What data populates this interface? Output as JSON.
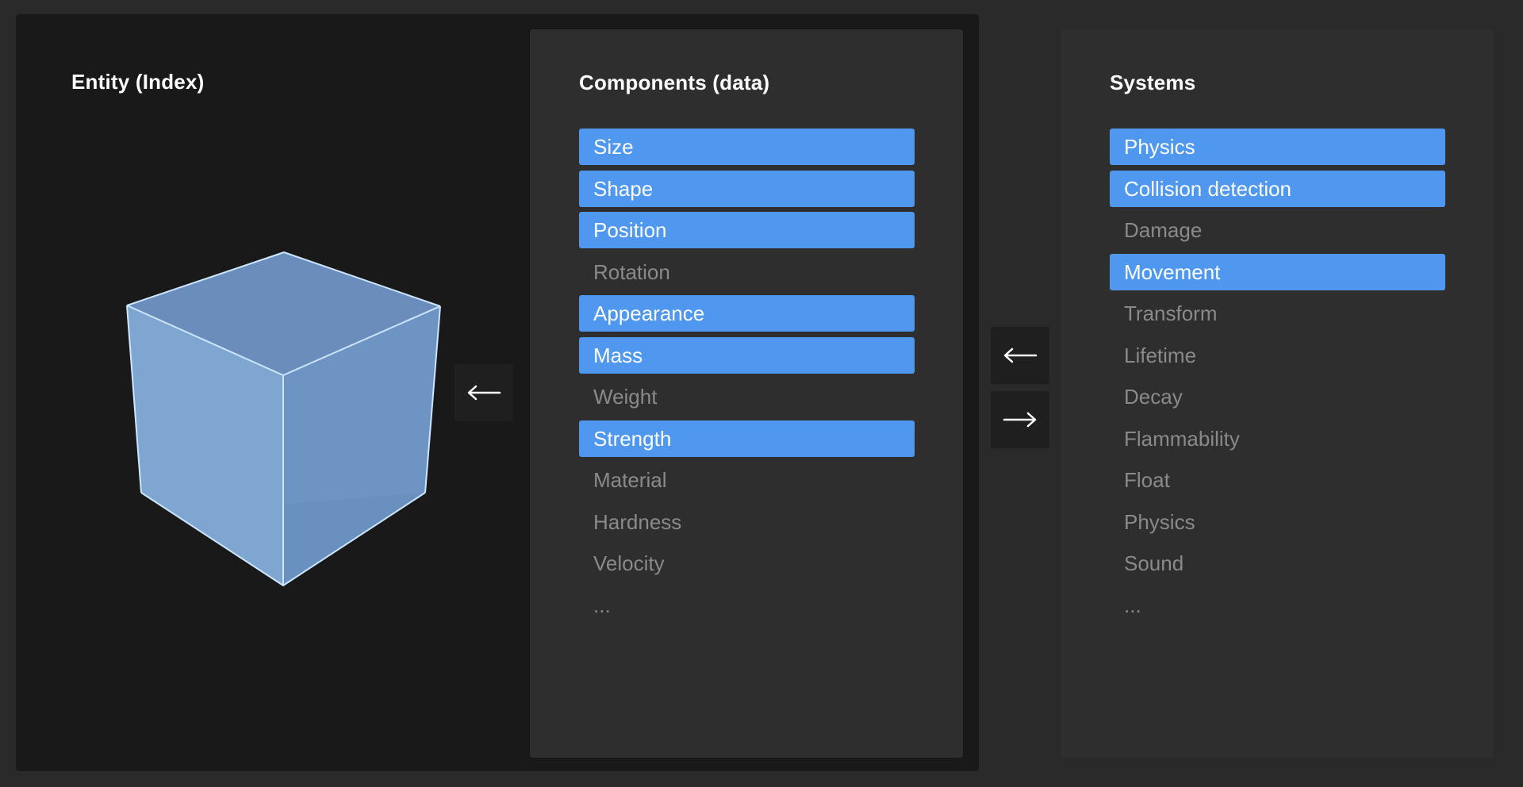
{
  "entity": {
    "title": "Entity (Index)",
    "cube_color": "#7aa4d0",
    "edge_color": "#cde6ff"
  },
  "components": {
    "title": "Components (data)",
    "items": [
      {
        "label": "Size",
        "active": true
      },
      {
        "label": "Shape",
        "active": true
      },
      {
        "label": "Position",
        "active": true
      },
      {
        "label": "Rotation",
        "active": false
      },
      {
        "label": "Appearance",
        "active": true
      },
      {
        "label": "Mass",
        "active": true
      },
      {
        "label": "Weight",
        "active": false
      },
      {
        "label": "Strength",
        "active": true
      },
      {
        "label": "Material",
        "active": false
      },
      {
        "label": "Hardness",
        "active": false
      },
      {
        "label": "Velocity",
        "active": false
      },
      {
        "label": "...",
        "active": false
      }
    ]
  },
  "systems": {
    "title": "Systems",
    "items": [
      {
        "label": "Physics",
        "active": true
      },
      {
        "label": "Collision detection",
        "active": true
      },
      {
        "label": "Damage",
        "active": false
      },
      {
        "label": "Movement",
        "active": true
      },
      {
        "label": "Transform",
        "active": false
      },
      {
        "label": "Lifetime",
        "active": false
      },
      {
        "label": "Decay",
        "active": false
      },
      {
        "label": "Flammability",
        "active": false
      },
      {
        "label": "Float",
        "active": false
      },
      {
        "label": "Physics",
        "active": false
      },
      {
        "label": "Sound",
        "active": false
      },
      {
        "label": "...",
        "active": false
      }
    ]
  },
  "arrows": {
    "components_to_entity": "arrow-left-icon",
    "systems_to_components": "arrow-left-icon",
    "components_to_systems": "arrow-right-icon"
  },
  "colors": {
    "active_item": "#4f97ef",
    "inactive_text": "#8a8a8a",
    "panel_dark": "#191919",
    "panel": "#2e2e2e",
    "background": "#2a2a2a"
  }
}
